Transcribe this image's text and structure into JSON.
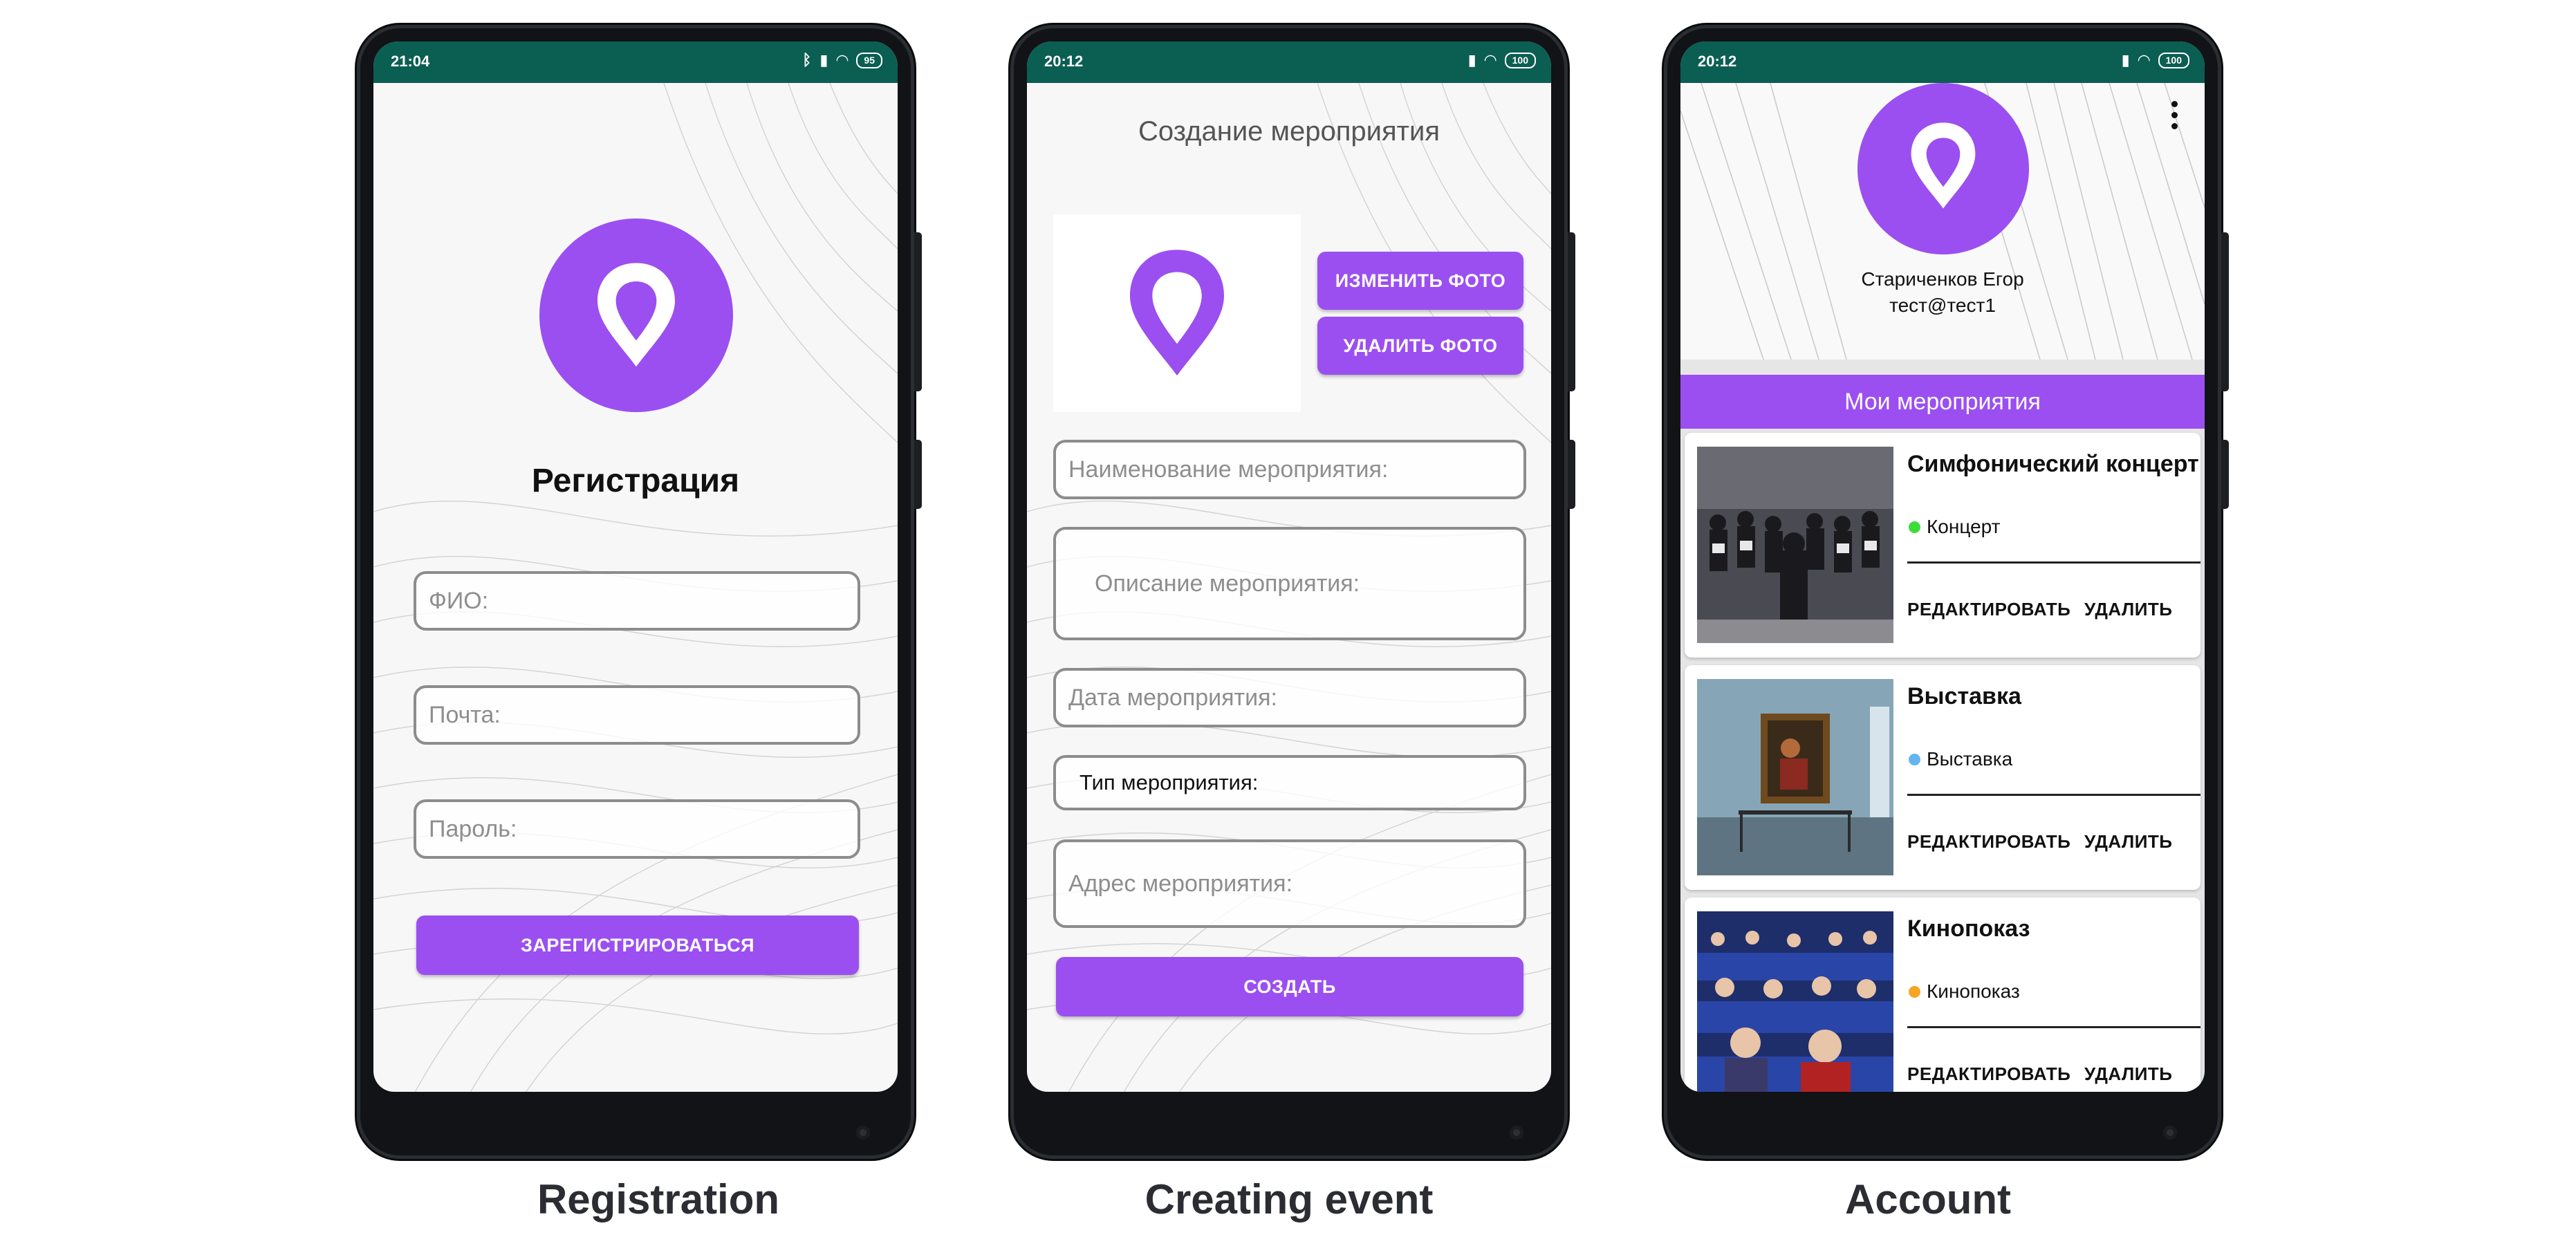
{
  "colors": {
    "accent": "#9b4ff0",
    "statusbar": "#0b5e52",
    "dot_concert": "#3ddc3a",
    "dot_exhibition": "#62b5f0",
    "dot_movie": "#f5a623"
  },
  "screens": {
    "registration": {
      "status": {
        "time": "21:04",
        "battery": "95"
      },
      "title": "Регистрация",
      "fields": {
        "fio": "ФИО:",
        "email": "Почта:",
        "password": "Пароль:"
      },
      "submit": "ЗАРЕГИСТРИРОВАТЬСЯ",
      "caption": "Registration"
    },
    "create_event": {
      "status": {
        "time": "20:12",
        "battery": "100"
      },
      "title": "Создание мероприятия",
      "change_photo": "ИЗМЕНИТЬ ФОТО",
      "delete_photo": "УДАЛИТЬ ФОТО",
      "fields": {
        "name": "Наименование мероприятия:",
        "description": "Описание мероприятия:",
        "date": "Дата мероприятия:",
        "type": "Тип мероприятия:",
        "address": "Адрес мероприятия:"
      },
      "submit": "СОЗДАТЬ",
      "caption": "Creating event"
    },
    "account": {
      "status": {
        "time": "20:12",
        "battery": "100"
      },
      "user_name": "Стариченков Егор",
      "user_email": "тест@тест1",
      "section_title": "Мои мероприятия",
      "events": [
        {
          "title": "Симфонический концерт",
          "type": "Концерт",
          "thumb": "orchestra-photo",
          "edit": "РЕДАКТИРОВАТЬ",
          "delete": "УДАЛИТЬ"
        },
        {
          "title": "Выставка",
          "type": "Выставка",
          "thumb": "painting-exhibition-photo",
          "edit": "РЕДАКТИРОВАТЬ",
          "delete": "УДАЛИТЬ"
        },
        {
          "title": "Кинопоказ",
          "type": "Кинопоказ",
          "thumb": "cinema-audience-photo",
          "edit": "РЕДАКТИРОВАТЬ",
          "delete": "УДАЛИТЬ"
        }
      ],
      "caption": "Account"
    }
  }
}
